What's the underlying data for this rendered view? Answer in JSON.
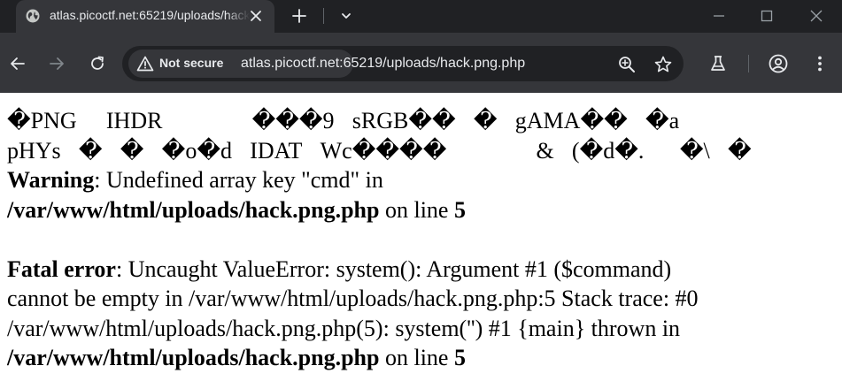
{
  "browser": {
    "tab": {
      "title": "atlas.picoctf.net:65219/uploads/hack.png.php",
      "icon": "globe-icon"
    },
    "security_chip": "Not secure",
    "url": "atlas.picoctf.net:65219/uploads/hack.png.php",
    "colors": {
      "tabstrip": "#202124",
      "toolbar": "#35363a",
      "omnibox": "#202124",
      "text": "#e8eaed",
      "icon": "#c4c7c5"
    }
  },
  "page": {
    "binary_line_1": "�PNG \u0000 IHDR\u0000\u0000\u0000\u0000\u0000���9\u0000sRGB��\u0000�\u0000gAMA��\u0000�a\u0000",
    "binary_line_2": "pHYs\u0000�\u0000�\u0000�o�d\u0000IDAT\u0000Wc����\u0000\u0000\u0000\u0000\u0000&\u0000(�d�.\u0000\u0000�\\\u0000�",
    "warning": {
      "label": "Warning",
      "message": ": Undefined array key \"cmd\" in",
      "file": "/var/www/html/uploads/hack.png.php",
      "on_line": " on line ",
      "line": "5"
    },
    "fatal": {
      "label": "Fatal error",
      "message_1": ": Uncaught ValueError: system(): Argument #1 ($command)",
      "message_2": "cannot be empty in /var/www/html/uploads/hack.png.php:5 Stack trace: #0",
      "message_3": "/var/www/html/uploads/hack.png.php(5): system('') #1 {main} thrown in",
      "file": "/var/www/html/uploads/hack.png.php",
      "on_line": " on line ",
      "line": "5"
    }
  }
}
